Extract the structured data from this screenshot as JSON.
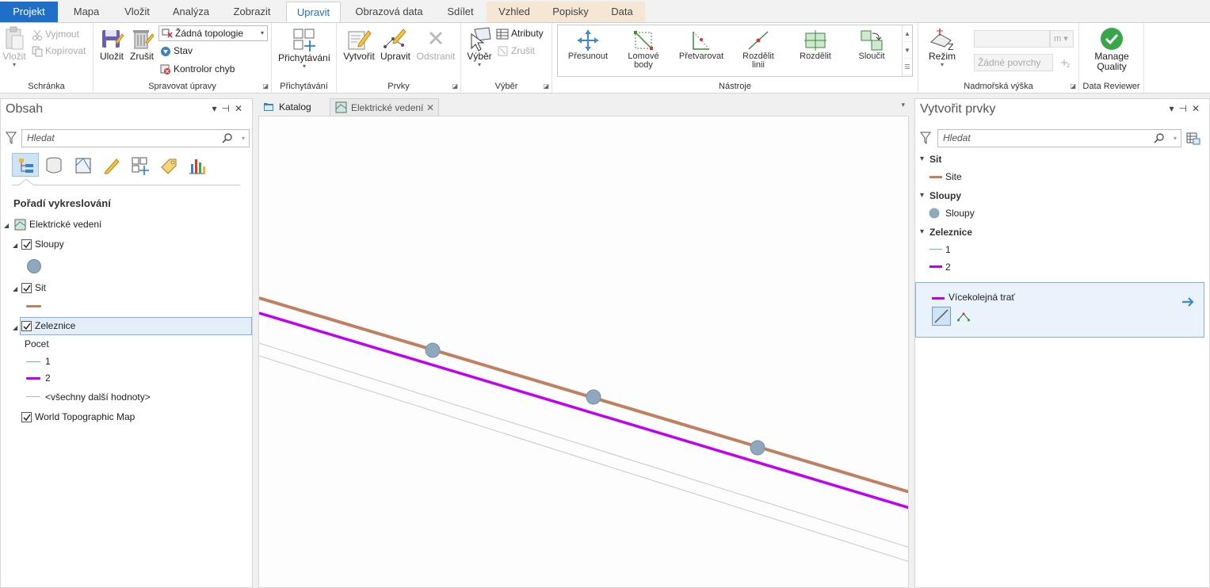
{
  "tabs": [
    "Projekt",
    "Mapa",
    "Vložit",
    "Analýza",
    "Zobrazit",
    "Upravit",
    "Obrazová data",
    "Sdílet",
    "Vzhled",
    "Popisky",
    "Data"
  ],
  "ribbon": {
    "schranka": {
      "label": "Schránka",
      "vlozit": "Vložit",
      "vyjmout": "Vyjmout",
      "kopirovat": "Kopírovat"
    },
    "spravovat": {
      "label": "Spravovat úpravy",
      "ulozit": "Uložit",
      "zrusit": "Zrušit",
      "topologie": "Žádná topologie",
      "stav": "Stav",
      "kontrolor": "Kontrolor chyb"
    },
    "prichytavani": {
      "label": "Přichytávání",
      "button": "Přichytávání"
    },
    "prvky": {
      "label": "Prvky",
      "vytvorit": "Vytvořit",
      "upravit": "Upravit",
      "odstranit": "Odstranit"
    },
    "vyber": {
      "label": "Výběr",
      "vyber": "Výběr",
      "atributy": "Atributy",
      "zrusit": "Zrušit"
    },
    "nastroje": {
      "label": "Nástroje",
      "tools": [
        {
          "l1": "Přesunout",
          "l2": ""
        },
        {
          "l1": "Lomové",
          "l2": "body"
        },
        {
          "l1": "Přetvarovat",
          "l2": ""
        },
        {
          "l1": "Rozdělit",
          "l2": "linii"
        },
        {
          "l1": "Rozdělit",
          "l2": ""
        },
        {
          "l1": "Sloučit",
          "l2": ""
        }
      ]
    },
    "vyska": {
      "label": "Nadmořská výška",
      "rezim": "Režim",
      "unit": "m",
      "povrchy": "Žádné povrchy"
    },
    "reviewer": {
      "label": "Data Reviewer",
      "l1": "Manage",
      "l2": "Quality"
    }
  },
  "contents": {
    "title": "Obsah",
    "search_placeholder": "Hledat",
    "drawing_order": "Pořadí vykreslování",
    "map_name": "Elektrické vedení",
    "layers": {
      "sloupy": "Sloupy",
      "sit": "Sit",
      "zeleznice": "Zeleznice",
      "field": "Pocet",
      "class1": "1",
      "class2": "2",
      "others": "<všechny další hodnoty>",
      "basemap": "World Topographic Map"
    }
  },
  "map_tabs": {
    "catalog": "Katalog",
    "map": "Elektrické vedení"
  },
  "create_features": {
    "title": "Vytvořit prvky",
    "search_placeholder": "Hledat",
    "groups": [
      {
        "name": "Sit",
        "items": [
          "Site"
        ]
      },
      {
        "name": "Sloupy",
        "items": [
          "Sloupy"
        ]
      },
      {
        "name": "Zeleznice",
        "items": [
          "1",
          "2"
        ]
      }
    ],
    "template": "Vícekolejná trať"
  },
  "colors": {
    "accent": "#1f6ec7",
    "sit": "#c0805f",
    "zeleznice_2": "#c000f0",
    "zeleznice_1": "#5fbfae",
    "sloupy": "#8fa8bd",
    "other_lines": "#c8c8c8"
  }
}
